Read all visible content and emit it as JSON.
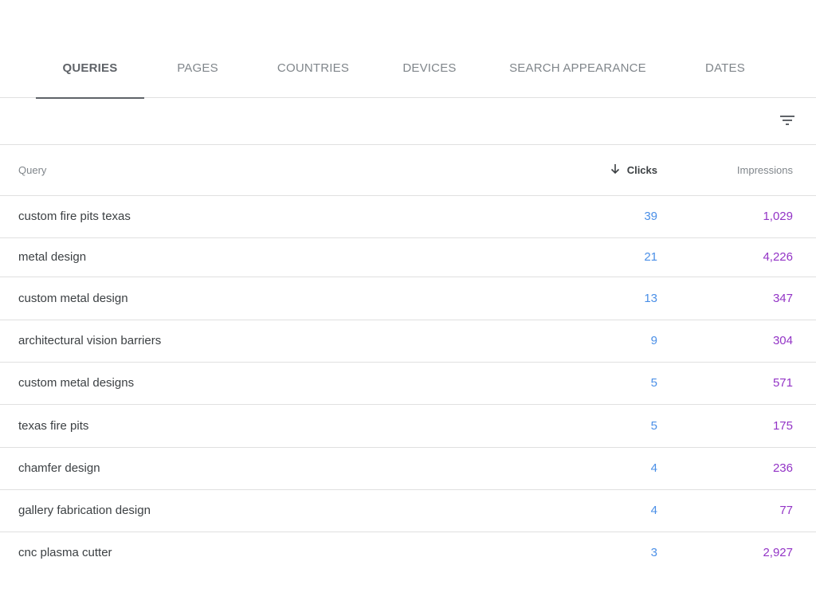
{
  "tabs": [
    {
      "label": "QUERIES",
      "active": true
    },
    {
      "label": "PAGES",
      "active": false
    },
    {
      "label": "COUNTRIES",
      "active": false
    },
    {
      "label": "DEVICES",
      "active": false
    },
    {
      "label": "SEARCH APPEARANCE",
      "active": false
    },
    {
      "label": "DATES",
      "active": false
    }
  ],
  "toolbar": {
    "filter_icon": "filter-list-icon"
  },
  "table": {
    "columns": {
      "query": "Query",
      "clicks": "Clicks",
      "impressions": "Impressions"
    },
    "sort": {
      "column": "Clicks",
      "direction": "descending",
      "icon": "arrow-down-icon"
    },
    "colors": {
      "clicks": "#4a8fe7",
      "impressions": "#9334c6"
    },
    "rows": [
      {
        "query": "custom fire pits texas",
        "clicks": "39",
        "impressions": "1,029"
      },
      {
        "query": "metal design",
        "clicks": "21",
        "impressions": "4,226"
      },
      {
        "query": "custom metal design",
        "clicks": "13",
        "impressions": "347"
      },
      {
        "query": "architectural vision barriers",
        "clicks": "9",
        "impressions": "304"
      },
      {
        "query": "custom metal designs",
        "clicks": "5",
        "impressions": "571"
      },
      {
        "query": "texas fire pits",
        "clicks": "5",
        "impressions": "175"
      },
      {
        "query": "chamfer design",
        "clicks": "4",
        "impressions": "236"
      },
      {
        "query": "gallery fabrication design",
        "clicks": "4",
        "impressions": "77"
      },
      {
        "query": "cnc plasma cutter",
        "clicks": "3",
        "impressions": "2,927"
      }
    ]
  }
}
